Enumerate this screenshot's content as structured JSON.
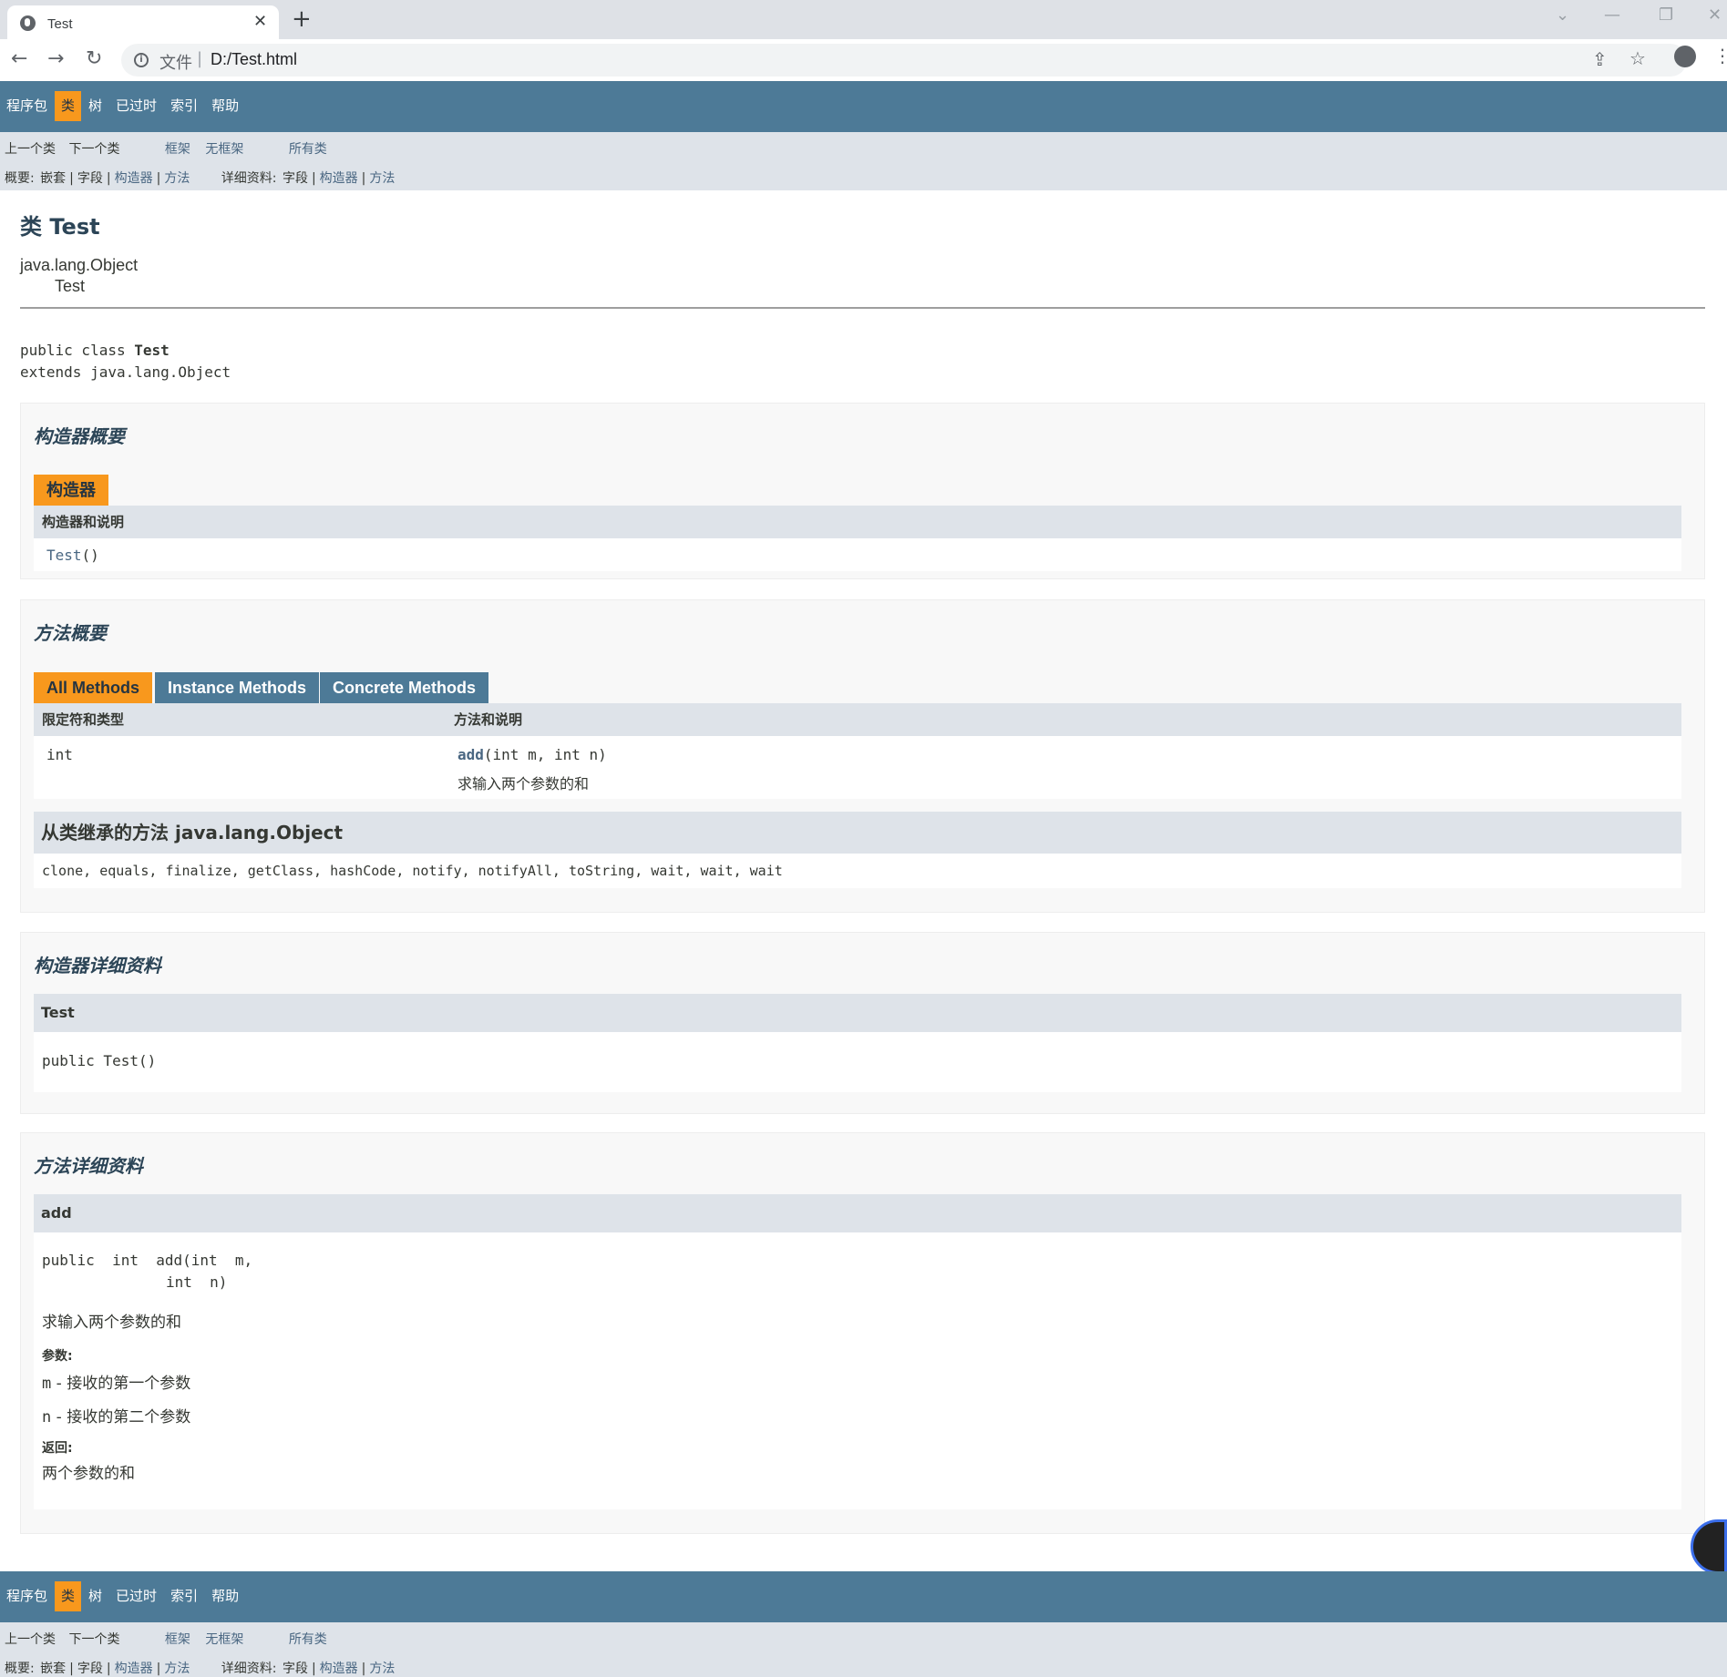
{
  "browser": {
    "tab_title": "Test",
    "tab_close": "✕",
    "new_tab": "+",
    "protocol_label": "文件",
    "url": "D:/Test.html"
  },
  "nav": {
    "package": "程序包",
    "class": "类",
    "tree": "树",
    "deprecated": "已过时",
    "index": "索引",
    "help": "帮助"
  },
  "subnav": {
    "prev_class": "上一个类",
    "next_class": "下一个类",
    "frames": "框架",
    "no_frames": "无框架",
    "all_classes": "所有类",
    "summary_label": "概要:",
    "summary_nested": "嵌套",
    "summary_field": "字段",
    "summary_constr": "构造器",
    "summary_method": "方法",
    "detail_label": "详细资料:",
    "detail_field": "字段",
    "detail_constr": "构造器",
    "detail_method": "方法",
    "sep": "|"
  },
  "header": {
    "title": "类 Test",
    "inherit_parent": "java.lang.Object",
    "inherit_child": "Test",
    "decl_modifiers": "public class",
    "decl_name": "Test",
    "decl_extends": "extends java.lang.Object"
  },
  "constructor_summary": {
    "heading": "构造器概要",
    "tab": "构造器",
    "column": "构造器和说明",
    "row_name": "Test",
    "row_params": "()"
  },
  "method_summary": {
    "heading": "方法概要",
    "tabs": [
      "All Methods",
      "Instance Methods",
      "Concrete Methods"
    ],
    "col_modifier": "限定符和类型",
    "col_method": "方法和说明",
    "row_type": "int",
    "row_method_name": "add",
    "row_method_params": "(int  m, int  n)",
    "row_desc": "求输入两个参数的和",
    "inherited_heading": "从类继承的方法 java.lang.Object",
    "inherited_methods": "clone, equals, finalize, getClass, hashCode, notify, notifyAll, toString, wait, wait, wait"
  },
  "constructor_detail": {
    "heading": "构造器详细资料",
    "name": "Test",
    "signature": "public  Test()"
  },
  "method_detail": {
    "heading": "方法详细资料",
    "name": "add",
    "signature_line1": "public  int  add(int  m,",
    "signature_line2": "int  n)",
    "desc": "求输入两个参数的和",
    "params_label": "参数:",
    "param_m_name": "m",
    "param_m_desc": " - 接收的第一个参数",
    "param_n_name": "n",
    "param_n_desc": " - 接收的第二个参数",
    "returns_label": "返回:",
    "returns_desc": "两个参数的和"
  },
  "colors": {
    "nav_bg": "#4d7a97",
    "accent": "#f8981d",
    "subnav_bg": "#dee3e9"
  }
}
